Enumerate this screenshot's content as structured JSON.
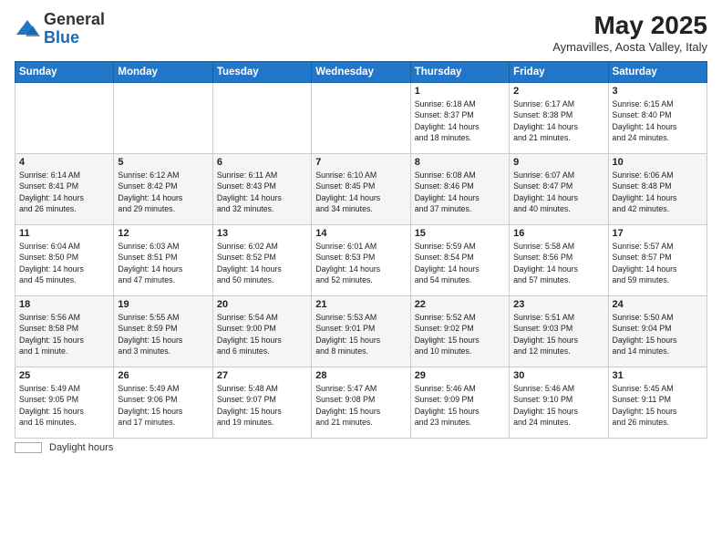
{
  "header": {
    "logo_general": "General",
    "logo_blue": "Blue",
    "month_title": "May 2025",
    "location": "Aymavilles, Aosta Valley, Italy"
  },
  "weekdays": [
    "Sunday",
    "Monday",
    "Tuesday",
    "Wednesday",
    "Thursday",
    "Friday",
    "Saturday"
  ],
  "weeks": [
    [
      {
        "day": "",
        "info": ""
      },
      {
        "day": "",
        "info": ""
      },
      {
        "day": "",
        "info": ""
      },
      {
        "day": "",
        "info": ""
      },
      {
        "day": "1",
        "info": "Sunrise: 6:18 AM\nSunset: 8:37 PM\nDaylight: 14 hours\nand 18 minutes."
      },
      {
        "day": "2",
        "info": "Sunrise: 6:17 AM\nSunset: 8:38 PM\nDaylight: 14 hours\nand 21 minutes."
      },
      {
        "day": "3",
        "info": "Sunrise: 6:15 AM\nSunset: 8:40 PM\nDaylight: 14 hours\nand 24 minutes."
      }
    ],
    [
      {
        "day": "4",
        "info": "Sunrise: 6:14 AM\nSunset: 8:41 PM\nDaylight: 14 hours\nand 26 minutes."
      },
      {
        "day": "5",
        "info": "Sunrise: 6:12 AM\nSunset: 8:42 PM\nDaylight: 14 hours\nand 29 minutes."
      },
      {
        "day": "6",
        "info": "Sunrise: 6:11 AM\nSunset: 8:43 PM\nDaylight: 14 hours\nand 32 minutes."
      },
      {
        "day": "7",
        "info": "Sunrise: 6:10 AM\nSunset: 8:45 PM\nDaylight: 14 hours\nand 34 minutes."
      },
      {
        "day": "8",
        "info": "Sunrise: 6:08 AM\nSunset: 8:46 PM\nDaylight: 14 hours\nand 37 minutes."
      },
      {
        "day": "9",
        "info": "Sunrise: 6:07 AM\nSunset: 8:47 PM\nDaylight: 14 hours\nand 40 minutes."
      },
      {
        "day": "10",
        "info": "Sunrise: 6:06 AM\nSunset: 8:48 PM\nDaylight: 14 hours\nand 42 minutes."
      }
    ],
    [
      {
        "day": "11",
        "info": "Sunrise: 6:04 AM\nSunset: 8:50 PM\nDaylight: 14 hours\nand 45 minutes."
      },
      {
        "day": "12",
        "info": "Sunrise: 6:03 AM\nSunset: 8:51 PM\nDaylight: 14 hours\nand 47 minutes."
      },
      {
        "day": "13",
        "info": "Sunrise: 6:02 AM\nSunset: 8:52 PM\nDaylight: 14 hours\nand 50 minutes."
      },
      {
        "day": "14",
        "info": "Sunrise: 6:01 AM\nSunset: 8:53 PM\nDaylight: 14 hours\nand 52 minutes."
      },
      {
        "day": "15",
        "info": "Sunrise: 5:59 AM\nSunset: 8:54 PM\nDaylight: 14 hours\nand 54 minutes."
      },
      {
        "day": "16",
        "info": "Sunrise: 5:58 AM\nSunset: 8:56 PM\nDaylight: 14 hours\nand 57 minutes."
      },
      {
        "day": "17",
        "info": "Sunrise: 5:57 AM\nSunset: 8:57 PM\nDaylight: 14 hours\nand 59 minutes."
      }
    ],
    [
      {
        "day": "18",
        "info": "Sunrise: 5:56 AM\nSunset: 8:58 PM\nDaylight: 15 hours\nand 1 minute."
      },
      {
        "day": "19",
        "info": "Sunrise: 5:55 AM\nSunset: 8:59 PM\nDaylight: 15 hours\nand 3 minutes."
      },
      {
        "day": "20",
        "info": "Sunrise: 5:54 AM\nSunset: 9:00 PM\nDaylight: 15 hours\nand 6 minutes."
      },
      {
        "day": "21",
        "info": "Sunrise: 5:53 AM\nSunset: 9:01 PM\nDaylight: 15 hours\nand 8 minutes."
      },
      {
        "day": "22",
        "info": "Sunrise: 5:52 AM\nSunset: 9:02 PM\nDaylight: 15 hours\nand 10 minutes."
      },
      {
        "day": "23",
        "info": "Sunrise: 5:51 AM\nSunset: 9:03 PM\nDaylight: 15 hours\nand 12 minutes."
      },
      {
        "day": "24",
        "info": "Sunrise: 5:50 AM\nSunset: 9:04 PM\nDaylight: 15 hours\nand 14 minutes."
      }
    ],
    [
      {
        "day": "25",
        "info": "Sunrise: 5:49 AM\nSunset: 9:05 PM\nDaylight: 15 hours\nand 16 minutes."
      },
      {
        "day": "26",
        "info": "Sunrise: 5:49 AM\nSunset: 9:06 PM\nDaylight: 15 hours\nand 17 minutes."
      },
      {
        "day": "27",
        "info": "Sunrise: 5:48 AM\nSunset: 9:07 PM\nDaylight: 15 hours\nand 19 minutes."
      },
      {
        "day": "28",
        "info": "Sunrise: 5:47 AM\nSunset: 9:08 PM\nDaylight: 15 hours\nand 21 minutes."
      },
      {
        "day": "29",
        "info": "Sunrise: 5:46 AM\nSunset: 9:09 PM\nDaylight: 15 hours\nand 23 minutes."
      },
      {
        "day": "30",
        "info": "Sunrise: 5:46 AM\nSunset: 9:10 PM\nDaylight: 15 hours\nand 24 minutes."
      },
      {
        "day": "31",
        "info": "Sunrise: 5:45 AM\nSunset: 9:11 PM\nDaylight: 15 hours\nand 26 minutes."
      }
    ]
  ],
  "footer": {
    "daylight_label": "Daylight hours"
  }
}
